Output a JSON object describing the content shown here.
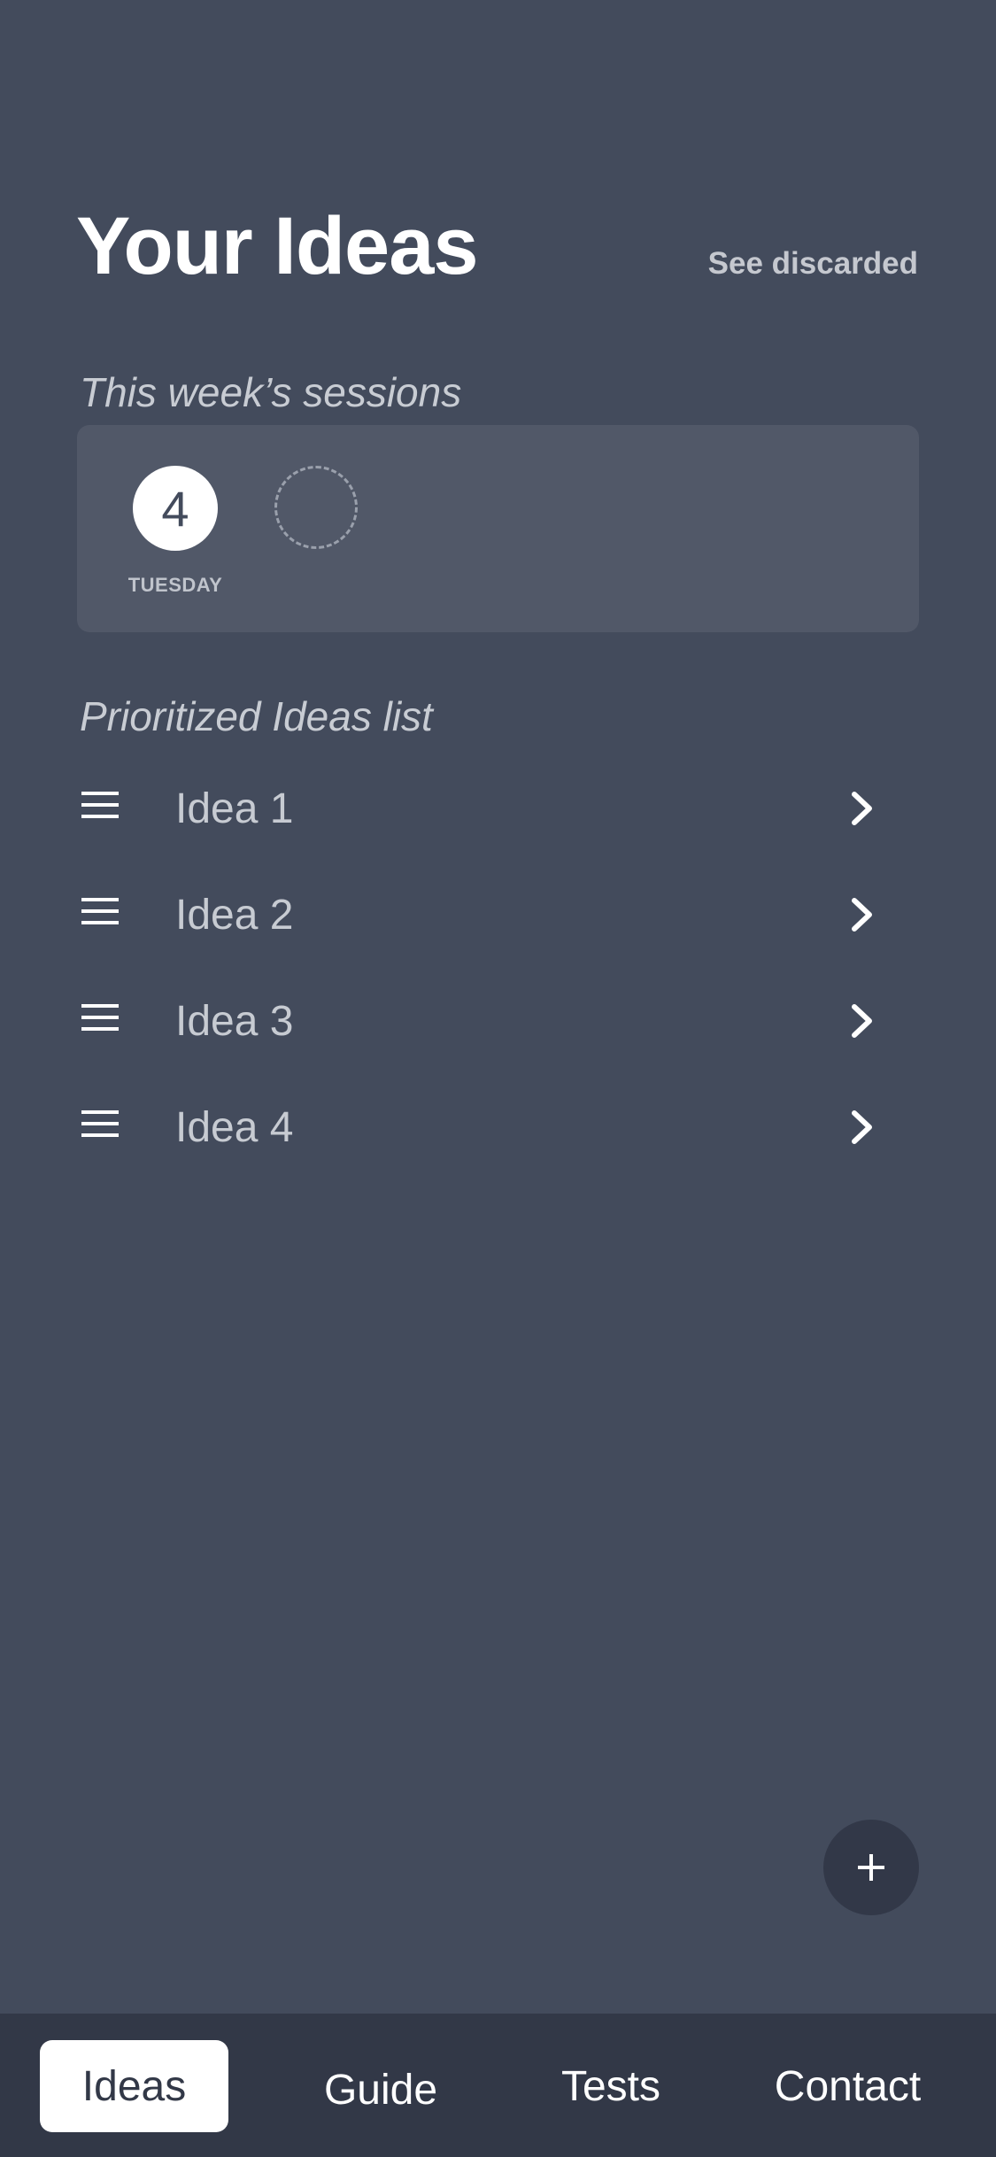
{
  "header": {
    "title": "Your Ideas",
    "see_discarded_label": "See discarded"
  },
  "sessions": {
    "label": "This week’s sessions",
    "days": [
      {
        "date": "4",
        "weekday": "TUESDAY",
        "state": "filled"
      },
      {
        "date": "",
        "weekday": "",
        "state": "empty"
      }
    ]
  },
  "ideas": {
    "label": "Prioritized Ideas list",
    "items": [
      {
        "label": "Idea 1",
        "icon": "drag-handle-icon"
      },
      {
        "label": "Idea 2",
        "icon": "drag-handle-icon"
      },
      {
        "label": "Idea 3",
        "icon": "drag-handle-icon"
      },
      {
        "label": "Idea 4",
        "icon": "drag-handle-icon"
      }
    ]
  },
  "fab": {
    "icon": "plus-icon"
  },
  "tabbar": {
    "tabs": [
      {
        "label": "Ideas",
        "active": true
      },
      {
        "label": "Guide",
        "active": false
      },
      {
        "label": "Tests",
        "active": false
      },
      {
        "label": "Contact",
        "active": false
      }
    ]
  },
  "colors": {
    "background": "#434b5c",
    "card": "#515868",
    "tabbar": "#323847",
    "fab": "#323848",
    "text_muted": "#c7cbd2"
  }
}
